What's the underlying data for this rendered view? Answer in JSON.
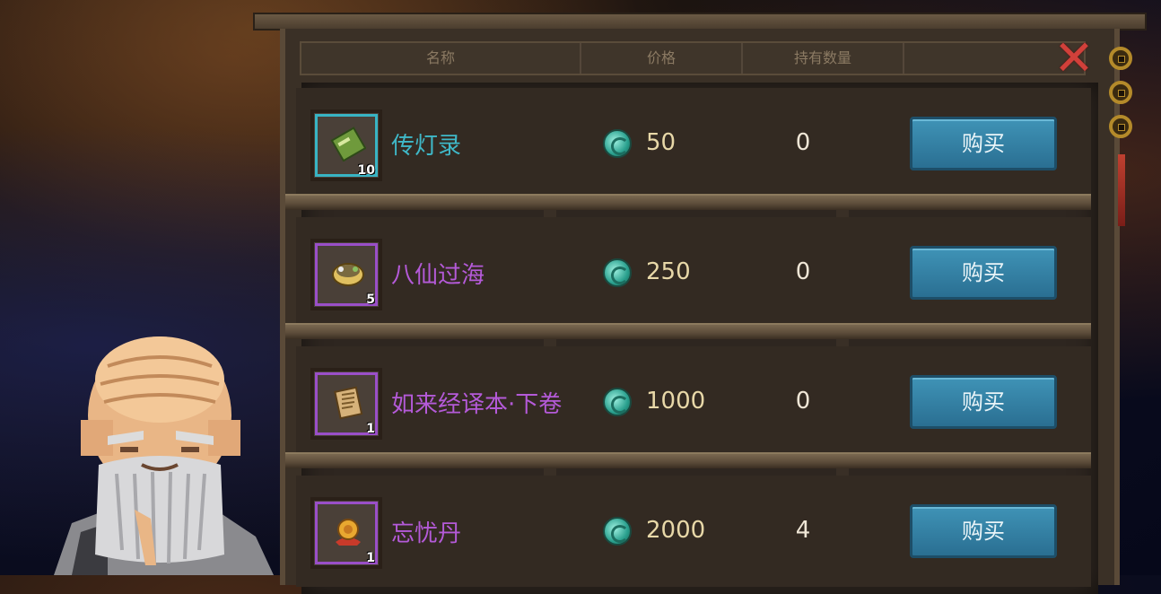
{
  "header": {
    "columns": [
      "名称",
      "价格",
      "持有数量",
      ""
    ]
  },
  "close_icon": "close-x-icon",
  "currency_icon": "jade-coin-icon",
  "items": [
    {
      "name": "传灯录",
      "rarity_color": "#3fb8c8",
      "icon": "green-book-icon",
      "stack": "10",
      "price": "50",
      "owned": "0",
      "buy_label": "购买"
    },
    {
      "name": "八仙过海",
      "rarity_color": "#b45ad8",
      "icon": "bowl-icon",
      "stack": "5",
      "price": "250",
      "owned": "0",
      "buy_label": "购买"
    },
    {
      "name": "如来经译本·下卷",
      "rarity_color": "#b45ad8",
      "icon": "scroll-icon",
      "stack": "1",
      "price": "1000",
      "owned": "0",
      "buy_label": "购买"
    },
    {
      "name": "忘忧丹",
      "rarity_color": "#b45ad8",
      "icon": "pill-icon",
      "stack": "1",
      "price": "2000",
      "owned": "4",
      "buy_label": "购买"
    }
  ],
  "npc": "elder-monk-portrait"
}
